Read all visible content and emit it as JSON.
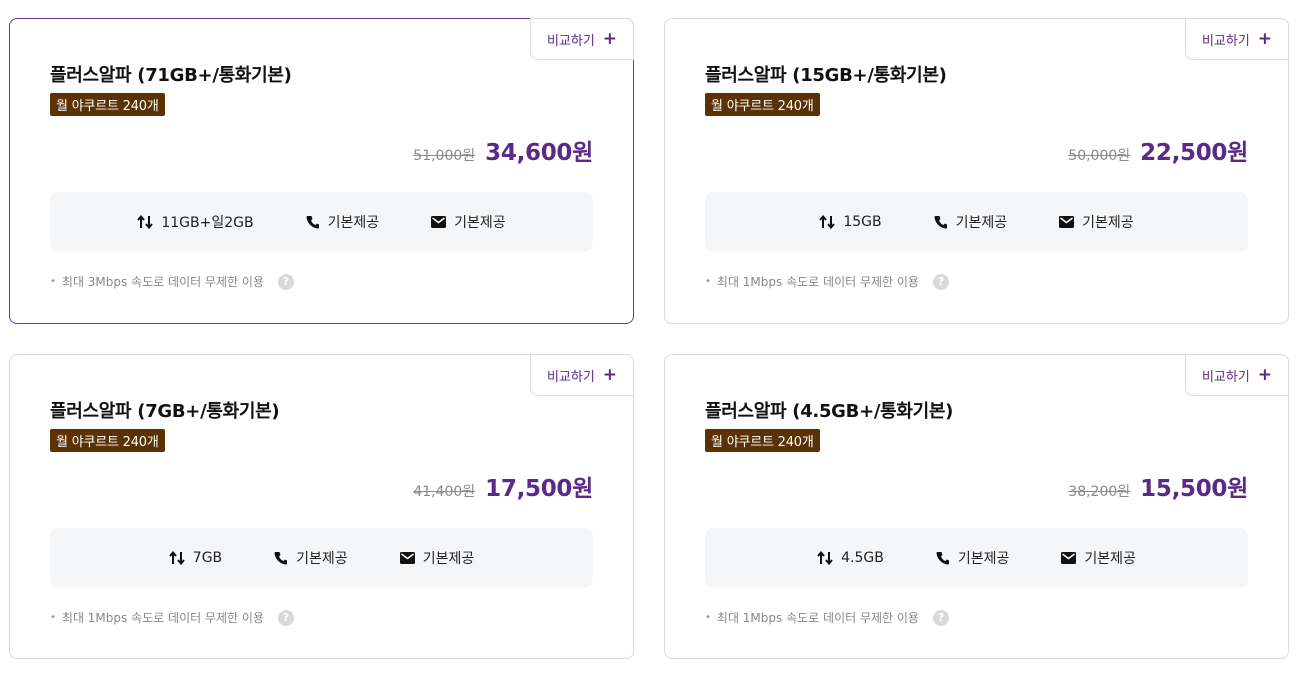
{
  "plans": [
    {
      "compare_label": "비교하기",
      "name": "플러스알파 (71GB+/통화기본)",
      "badge": "월 야쿠르트 240개",
      "original_price": "51,000원",
      "sale_price": "34,600원",
      "data": "11GB+일2GB",
      "voice": "기본제공",
      "sms": "기본제공",
      "note": "최대 3Mbps 속도로 데이터 무제한 이용",
      "selected": true
    },
    {
      "compare_label": "비교하기",
      "name": "플러스알파 (15GB+/통화기본)",
      "badge": "월 야쿠르트 240개",
      "original_price": "50,000원",
      "sale_price": "22,500원",
      "data": "15GB",
      "voice": "기본제공",
      "sms": "기본제공",
      "note": "최대 1Mbps 속도로 데이터 무제한 이용",
      "selected": false
    },
    {
      "compare_label": "비교하기",
      "name": "플러스알파 (7GB+/통화기본)",
      "badge": "월 야쿠르트 240개",
      "original_price": "41,400원",
      "sale_price": "17,500원",
      "data": "7GB",
      "voice": "기본제공",
      "sms": "기본제공",
      "note": "최대 1Mbps 속도로 데이터 무제한 이용",
      "selected": false
    },
    {
      "compare_label": "비교하기",
      "name": "플러스알파 (4.5GB+/통화기본)",
      "badge": "월 야쿠르트 240개",
      "original_price": "38,200원",
      "sale_price": "15,500원",
      "data": "4.5GB",
      "voice": "기본제공",
      "sms": "기본제공",
      "note": "최대 1Mbps 속도로 데이터 무제한 이용",
      "selected": false
    }
  ],
  "icons": {
    "compare": "plus-icon",
    "data": "data-transfer-icon",
    "voice": "phone-icon",
    "sms": "mail-icon",
    "help": "help-icon"
  },
  "colors": {
    "accent": "#5b2a86",
    "selected_border": "#6f3a8c",
    "badge_bg": "#5a3206",
    "feature_bg": "#f5f6f8"
  }
}
